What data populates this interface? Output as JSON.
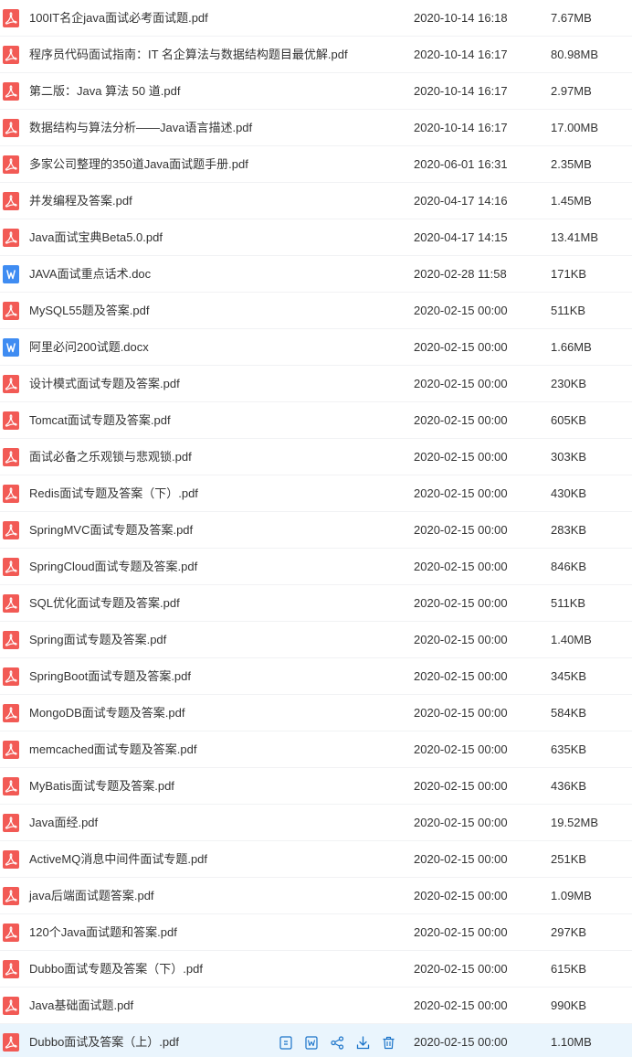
{
  "colors": {
    "pdf_icon": "#f25a55",
    "doc_icon": "#3f8cf2",
    "hover_row_bg": "#eaf5fd",
    "action_icon": "#1a73c9",
    "text": "#333333"
  },
  "files": [
    {
      "name": "100IT名企java面试必考面试题.pdf",
      "type": "pdf",
      "modified": "2020-10-14 16:18",
      "size": "7.67MB"
    },
    {
      "name": "程序员代码面试指南：IT 名企算法与数据结构题目最优解.pdf",
      "type": "pdf",
      "modified": "2020-10-14 16:17",
      "size": "80.98MB"
    },
    {
      "name": "第二版：Java  算法 50 道.pdf",
      "type": "pdf",
      "modified": "2020-10-14 16:17",
      "size": "2.97MB"
    },
    {
      "name": "数据结构与算法分析——Java语言描述.pdf",
      "type": "pdf",
      "modified": "2020-10-14 16:17",
      "size": "17.00MB"
    },
    {
      "name": "多家公司整理的350道Java面试题手册.pdf",
      "type": "pdf",
      "modified": "2020-06-01 16:31",
      "size": "2.35MB"
    },
    {
      "name": "并发编程及答案.pdf",
      "type": "pdf",
      "modified": "2020-04-17 14:16",
      "size": "1.45MB"
    },
    {
      "name": "Java面试宝典Beta5.0.pdf",
      "type": "pdf",
      "modified": "2020-04-17 14:15",
      "size": "13.41MB"
    },
    {
      "name": "JAVA面试重点话术.doc",
      "type": "doc",
      "modified": "2020-02-28 11:58",
      "size": "171KB"
    },
    {
      "name": "MySQL55题及答案.pdf",
      "type": "pdf",
      "modified": "2020-02-15 00:00",
      "size": "511KB"
    },
    {
      "name": "阿里必问200试题.docx",
      "type": "doc",
      "modified": "2020-02-15 00:00",
      "size": "1.66MB"
    },
    {
      "name": "设计模式面试专题及答案.pdf",
      "type": "pdf",
      "modified": "2020-02-15 00:00",
      "size": "230KB"
    },
    {
      "name": "Tomcat面试专题及答案.pdf",
      "type": "pdf",
      "modified": "2020-02-15 00:00",
      "size": "605KB"
    },
    {
      "name": "面试必备之乐观锁与悲观锁.pdf",
      "type": "pdf",
      "modified": "2020-02-15 00:00",
      "size": "303KB"
    },
    {
      "name": "Redis面试专题及答案（下）.pdf",
      "type": "pdf",
      "modified": "2020-02-15 00:00",
      "size": "430KB"
    },
    {
      "name": "SpringMVC面试专题及答案.pdf",
      "type": "pdf",
      "modified": "2020-02-15 00:00",
      "size": "283KB"
    },
    {
      "name": "SpringCloud面试专题及答案.pdf",
      "type": "pdf",
      "modified": "2020-02-15 00:00",
      "size": "846KB"
    },
    {
      "name": "SQL优化面试专题及答案.pdf",
      "type": "pdf",
      "modified": "2020-02-15 00:00",
      "size": "511KB"
    },
    {
      "name": "Spring面试专题及答案.pdf",
      "type": "pdf",
      "modified": "2020-02-15 00:00",
      "size": "1.40MB"
    },
    {
      "name": "SpringBoot面试专题及答案.pdf",
      "type": "pdf",
      "modified": "2020-02-15 00:00",
      "size": "345KB"
    },
    {
      "name": "MongoDB面试专题及答案.pdf",
      "type": "pdf",
      "modified": "2020-02-15 00:00",
      "size": "584KB"
    },
    {
      "name": "memcached面试专题及答案.pdf",
      "type": "pdf",
      "modified": "2020-02-15 00:00",
      "size": "635KB"
    },
    {
      "name": "MyBatis面试专题及答案.pdf",
      "type": "pdf",
      "modified": "2020-02-15 00:00",
      "size": "436KB"
    },
    {
      "name": "Java面经.pdf",
      "type": "pdf",
      "modified": "2020-02-15 00:00",
      "size": "19.52MB"
    },
    {
      "name": "ActiveMQ消息中间件面试专题.pdf",
      "type": "pdf",
      "modified": "2020-02-15 00:00",
      "size": "251KB"
    },
    {
      "name": "java后端面试题答案.pdf",
      "type": "pdf",
      "modified": "2020-02-15 00:00",
      "size": "1.09MB"
    },
    {
      "name": "120个Java面试题和答案.pdf",
      "type": "pdf",
      "modified": "2020-02-15 00:00",
      "size": "297KB"
    },
    {
      "name": "Dubbo面试专题及答案（下）.pdf",
      "type": "pdf",
      "modified": "2020-02-15 00:00",
      "size": "615KB"
    },
    {
      "name": "Java基础面试题.pdf",
      "type": "pdf",
      "modified": "2020-02-15 00:00",
      "size": "990KB"
    },
    {
      "name": "Dubbo面试及答案（上）.pdf",
      "type": "pdf",
      "modified": "2020-02-15 00:00",
      "size": "1.10MB",
      "hovered": true
    }
  ],
  "row_actions": [
    "preview-icon",
    "word-convert-icon",
    "share-icon",
    "download-icon",
    "delete-icon"
  ]
}
